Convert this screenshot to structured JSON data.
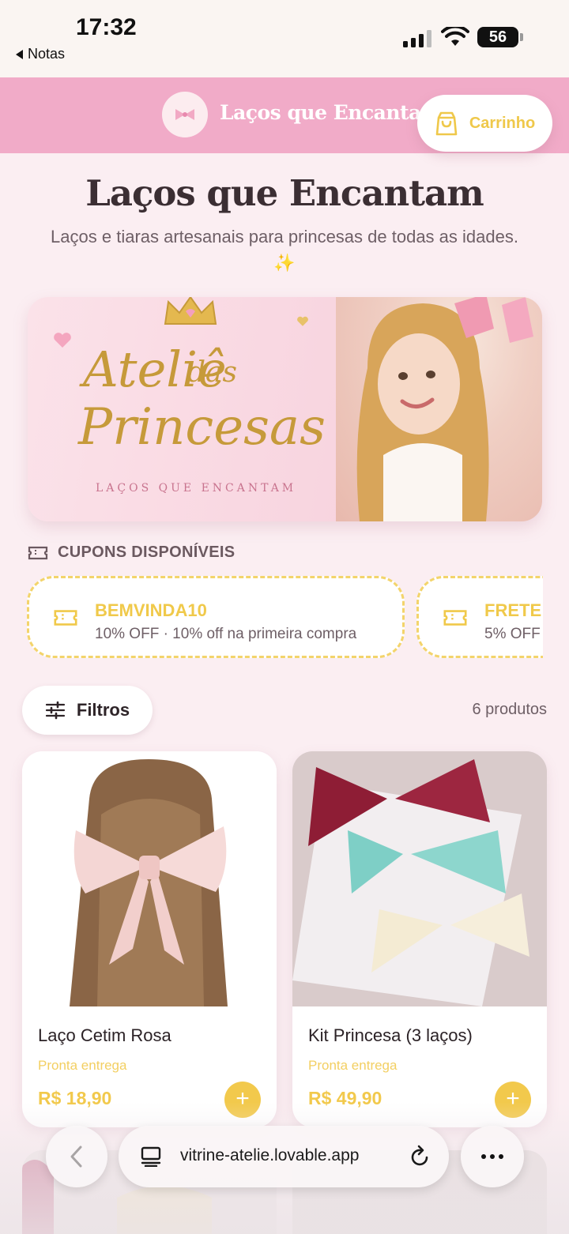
{
  "status_bar": {
    "time": "17:32",
    "back_label": "Notas",
    "battery": "56"
  },
  "header": {
    "title": "Laços que Encantam",
    "cart_label": "Carrinho"
  },
  "hero": {
    "title": "Laços que Encantam",
    "subtitle": "Laços e tiaras artesanais para princesas de todas as idades. ✨"
  },
  "banner": {
    "script_line1": "Ateliê",
    "script_line2": "das",
    "script_line3": "Princesas",
    "tagline": "LAÇOS QUE ENCANTAM"
  },
  "coupons": {
    "heading": "CUPONS DISPONÍVEIS",
    "items": [
      {
        "code": "BEMVINDA10",
        "desc": "10% OFF · 10% off na primeira compra"
      },
      {
        "code": "FRETE",
        "desc": "5% OFF"
      }
    ]
  },
  "filters": {
    "label": "Filtros",
    "count": "6 produtos"
  },
  "products": [
    {
      "name": "Laço Cetim Rosa",
      "stock": "Pronta entrega",
      "price": "R$ 18,90"
    },
    {
      "name": "Kit Princesa (3 laços)",
      "stock": "Pronta entrega",
      "price": "R$ 49,90"
    }
  ],
  "browser": {
    "url": "vitrine-atelie.lovable.app"
  },
  "colors": {
    "header_pink": "#f1abc8",
    "accent_gold": "#f2c94c",
    "page_bg": "#fbeef2"
  }
}
